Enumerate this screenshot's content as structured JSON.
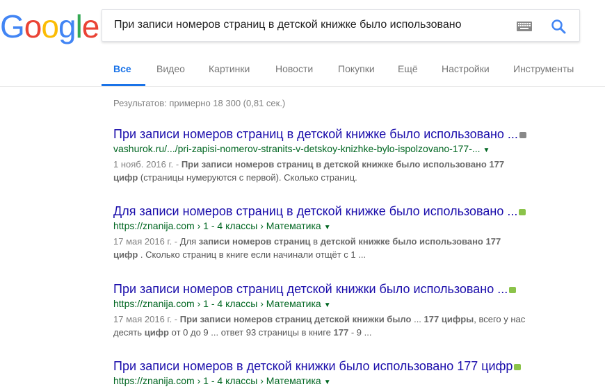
{
  "logo": {
    "letters": [
      "G",
      "o",
      "o",
      "g",
      "l",
      "e"
    ],
    "colors": [
      "#4285F4",
      "#EA4335",
      "#FBBC05",
      "#4285F4",
      "#34A853",
      "#EA4335"
    ]
  },
  "search": {
    "query": "При записи номеров страниц в детской книжке было использовано"
  },
  "tabs": [
    {
      "label": "Все",
      "active": true
    },
    {
      "label": "Видео"
    },
    {
      "label": "Картинки"
    },
    {
      "label": "Новости"
    },
    {
      "label": "Покупки"
    },
    {
      "label": "Ещё"
    },
    {
      "label": "Настройки"
    },
    {
      "label": "Инструменты"
    }
  ],
  "stats": "Результатов: примерно 18 300 (0,81 сек.)",
  "results": [
    {
      "title": "При записи номеров страниц в детской книжке было использовано ...",
      "url": "vashurok.ru/.../pri-zapisi-nomerov-stranits-v-detskoy-knizhke-bylo-ispolzovano-177-...",
      "badge_color": "#888888",
      "date": "1 нояб. 2016 г. - ",
      "line1_bold": "При записи номеров страниц в детской книжке было использовано 177",
      "line2_bold": "цифр",
      "line2_rest": " (страницы нумеруются с первой). Сколько страниц."
    },
    {
      "title": "Для записи номеров страниц в детской книжке было использовано ...",
      "url": "https://znanija.com › 1 - 4 классы › Математика",
      "badge_color": "#8bc34a",
      "date": "17 мая 2016 г. - ",
      "line1_pre": "Для ",
      "line1_bold": "записи номеров страниц",
      "line1_mid": " в ",
      "line1_bold2": "детской книжке было использовано 177",
      "line2_bold": "цифр",
      "line2_rest": " . Сколько страниц в книге если начинали отщёт с 1 ..."
    },
    {
      "title": "При записи номеров страниц детской книжки было использовано ...",
      "url": "https://znanija.com › 1 - 4 классы › Математика",
      "badge_color": "#8bc34a",
      "date": "17 мая 2016 г. - ",
      "line1_bold": "При записи номеров страниц детской книжки было",
      "line1_mid": " ... ",
      "line1_bold2": "177 цифры",
      "line1_rest": ", всего у нас",
      "line2_pre": "десять ",
      "line2_bold": "цифр",
      "line2_rest": " от 0 до 9 ... ответ 93 страницы в книге ",
      "line2_bold2": "177",
      "line2_rest2": " - 9 ..."
    },
    {
      "title": "При записи номеров в детской книжки было использовано 177 цифр",
      "url": "https://znanija.com › 1 - 4 классы › Математика",
      "badge_color": "#8bc34a"
    }
  ]
}
